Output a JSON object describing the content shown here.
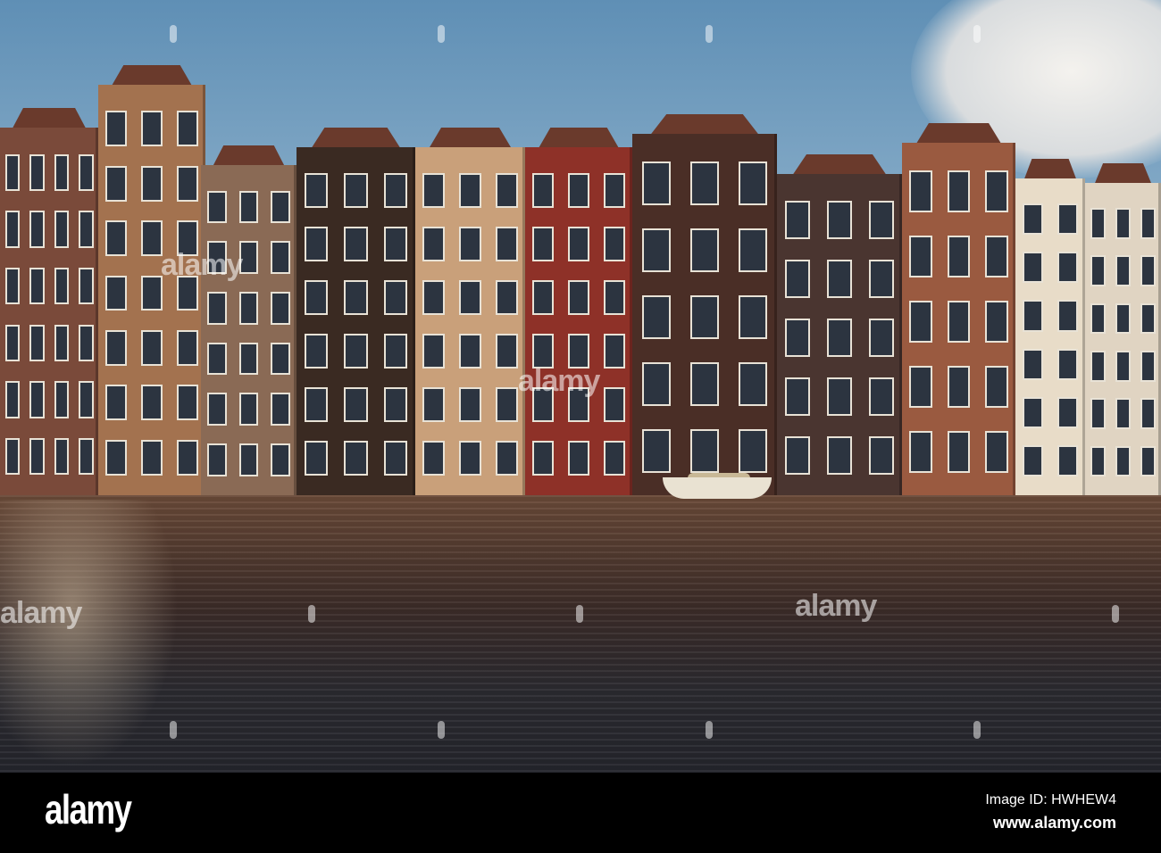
{
  "photo": {
    "subject": "Amsterdam canal houses"
  },
  "watermark": {
    "text": "alamy"
  },
  "footer": {
    "logo": "alamy",
    "image_id": "Image ID: HWHEW4",
    "website": "www.alamy.com"
  }
}
